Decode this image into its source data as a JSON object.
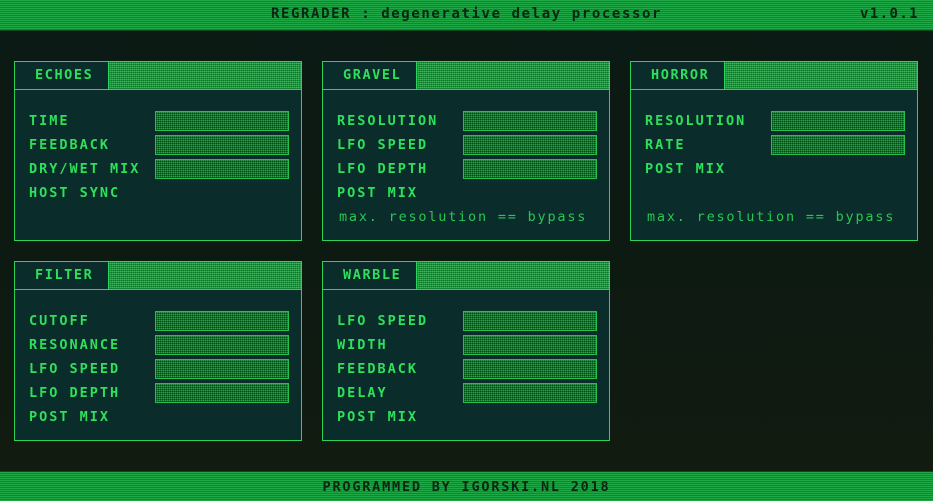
{
  "app": {
    "title": "REGRADER : degenerative delay processor",
    "version": "v1.0.1"
  },
  "panels": {
    "echoes": {
      "title": "ECHOES",
      "rows": [
        {
          "label": "TIME",
          "has_slider": true
        },
        {
          "label": "FEEDBACK",
          "has_slider": true
        },
        {
          "label": "DRY/WET MIX",
          "has_slider": true
        },
        {
          "label": "HOST SYNC",
          "has_slider": false
        }
      ]
    },
    "gravel": {
      "title": "GRAVEL",
      "rows": [
        {
          "label": "RESOLUTION",
          "has_slider": true
        },
        {
          "label": "LFO SPEED",
          "has_slider": true
        },
        {
          "label": "LFO DEPTH",
          "has_slider": true
        },
        {
          "label": "POST MIX",
          "has_slider": false
        }
      ],
      "note": "max. resolution == bypass"
    },
    "horror": {
      "title": "HORROR",
      "rows": [
        {
          "label": "RESOLUTION",
          "has_slider": true
        },
        {
          "label": "RATE",
          "has_slider": true
        },
        {
          "label": "POST MIX",
          "has_slider": false
        }
      ],
      "note": "max. resolution == bypass"
    },
    "filter": {
      "title": "FILTER",
      "rows": [
        {
          "label": "CUTOFF",
          "has_slider": true
        },
        {
          "label": "RESONANCE",
          "has_slider": true
        },
        {
          "label": "LFO SPEED",
          "has_slider": true
        },
        {
          "label": "LFO DEPTH",
          "has_slider": true
        },
        {
          "label": "POST MIX",
          "has_slider": false
        }
      ]
    },
    "warble": {
      "title": "WARBLE",
      "rows": [
        {
          "label": "LFO SPEED",
          "has_slider": true
        },
        {
          "label": "WIDTH",
          "has_slider": true
        },
        {
          "label": "FEEDBACK",
          "has_slider": true
        },
        {
          "label": "DELAY",
          "has_slider": true
        },
        {
          "label": "POST MIX",
          "has_slider": false
        }
      ]
    }
  },
  "footer": {
    "text": "PROGRAMMED BY IGORSKI.NL 2018"
  },
  "colors": {
    "accent": "#2ee05a",
    "panel_bg": "#0a2c2a",
    "bar_bg": "#1fa845"
  }
}
